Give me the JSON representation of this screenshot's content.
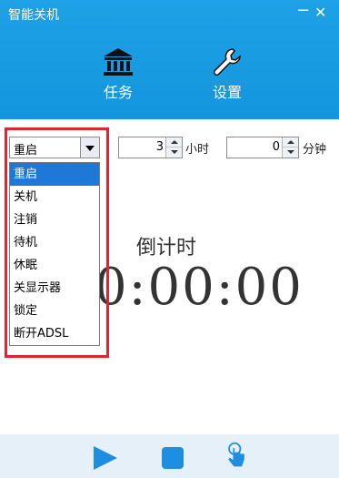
{
  "window": {
    "title": "智能关机",
    "minimize_glyph": "−",
    "close_glyph": "✕"
  },
  "tabs": [
    {
      "label": "任务",
      "icon": "bank-icon"
    },
    {
      "label": "设置",
      "icon": "wrench-icon"
    }
  ],
  "mode_select": {
    "value": "重启"
  },
  "dropdown": {
    "options": [
      "重启",
      "关机",
      "注销",
      "待机",
      "休眠",
      "关显示器",
      "锁定",
      "断开ADSL"
    ],
    "selected_index": 0
  },
  "hours": {
    "value": "3",
    "unit": "小时"
  },
  "minutes": {
    "value": "0",
    "unit": "分钟"
  },
  "countdown": {
    "label": "倒计时",
    "time": "0:00:00"
  },
  "footer": {
    "icons": [
      "play-icon",
      "stop-icon",
      "touch-icon"
    ]
  },
  "colors": {
    "accent": "#1496de",
    "highlight": "#1e78d7",
    "annotation": "#e0262d",
    "footer_bg": "#e6f0f8"
  }
}
